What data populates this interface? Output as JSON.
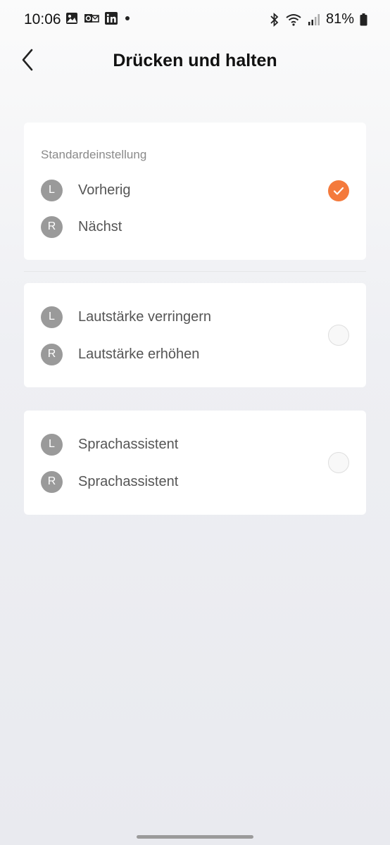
{
  "status_bar": {
    "time": "10:06",
    "left_icons": [
      "gallery-icon",
      "outlook-icon",
      "linkedin-icon",
      "dot-icon"
    ],
    "right_icons": [
      "bluetooth-icon",
      "wifi-icon",
      "signal-icon",
      "battery-icon"
    ],
    "battery": "81%"
  },
  "header": {
    "back_icon": "chevron-left-icon",
    "title": "Drücken und halten"
  },
  "options": [
    {
      "section_label": "Standardeinstellung",
      "left_badge": "L",
      "left_action": "Vorherig",
      "right_badge": "R",
      "right_action": "Nächst",
      "selected": true
    },
    {
      "left_badge": "L",
      "left_action": "Lautstärke verringern",
      "right_badge": "R",
      "right_action": "Lautstärke erhöhen",
      "selected": false
    },
    {
      "left_badge": "L",
      "left_action": "Sprachassistent",
      "right_badge": "R",
      "right_action": "Sprachassistent",
      "selected": false
    }
  ],
  "colors": {
    "accent": "#f47a3c",
    "badge": "#9a9a9a"
  }
}
